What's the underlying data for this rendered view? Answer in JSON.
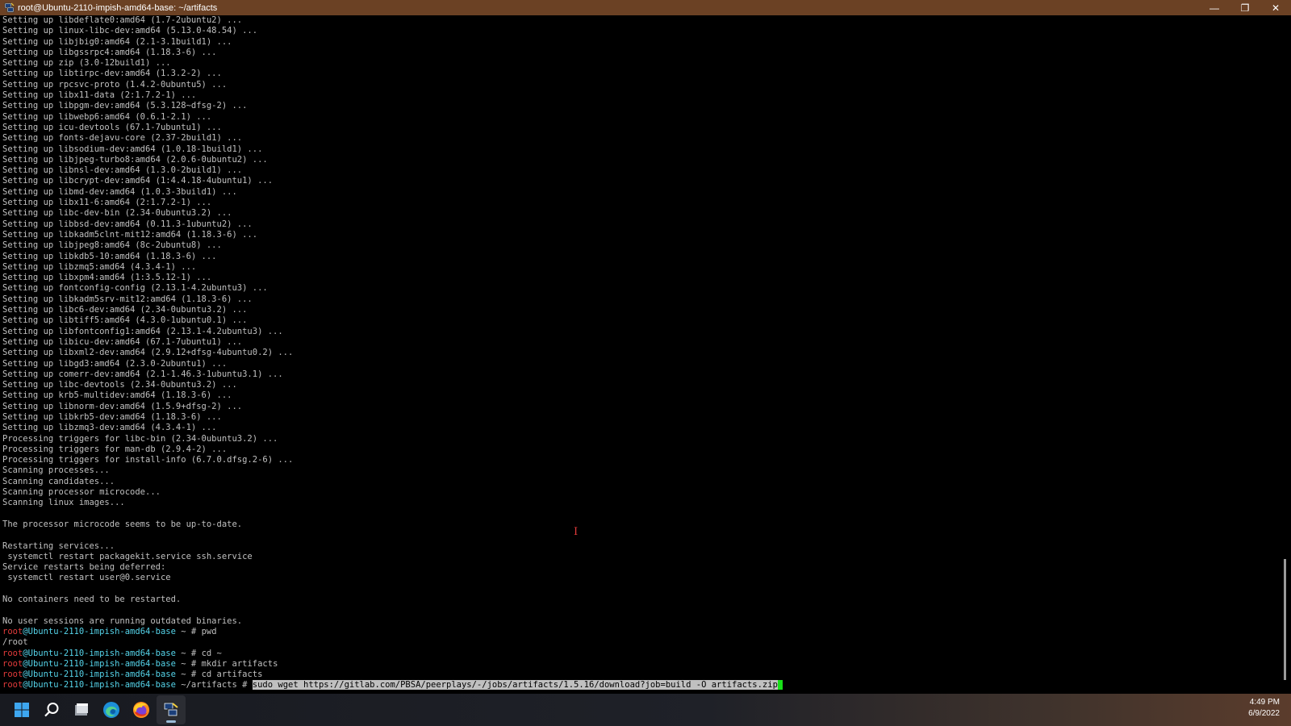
{
  "window": {
    "title": "root@Ubuntu-2110-impish-amd64-base: ~/artifacts",
    "minimize_label": "—",
    "maximize_label": "❐",
    "close_label": "✕"
  },
  "output_lines": [
    "Setting up libdeflate0:amd64 (1.7-2ubuntu2) ...",
    "Setting up linux-libc-dev:amd64 (5.13.0-48.54) ...",
    "Setting up libjbig0:amd64 (2.1-3.1build1) ...",
    "Setting up libgssrpc4:amd64 (1.18.3-6) ...",
    "Setting up zip (3.0-12build1) ...",
    "Setting up libtirpc-dev:amd64 (1.3.2-2) ...",
    "Setting up rpcsvc-proto (1.4.2-0ubuntu5) ...",
    "Setting up libx11-data (2:1.7.2-1) ...",
    "Setting up libpgm-dev:amd64 (5.3.128~dfsg-2) ...",
    "Setting up libwebp6:amd64 (0.6.1-2.1) ...",
    "Setting up icu-devtools (67.1-7ubuntu1) ...",
    "Setting up fonts-dejavu-core (2.37-2build1) ...",
    "Setting up libsodium-dev:amd64 (1.0.18-1build1) ...",
    "Setting up libjpeg-turbo8:amd64 (2.0.6-0ubuntu2) ...",
    "Setting up libnsl-dev:amd64 (1.3.0-2build1) ...",
    "Setting up libcrypt-dev:amd64 (1:4.4.18-4ubuntu1) ...",
    "Setting up libmd-dev:amd64 (1.0.3-3build1) ...",
    "Setting up libx11-6:amd64 (2:1.7.2-1) ...",
    "Setting up libc-dev-bin (2.34-0ubuntu3.2) ...",
    "Setting up libbsd-dev:amd64 (0.11.3-1ubuntu2) ...",
    "Setting up libkadm5clnt-mit12:amd64 (1.18.3-6) ...",
    "Setting up libjpeg8:amd64 (8c-2ubuntu8) ...",
    "Setting up libkdb5-10:amd64 (1.18.3-6) ...",
    "Setting up libzmq5:amd64 (4.3.4-1) ...",
    "Setting up libxpm4:amd64 (1:3.5.12-1) ...",
    "Setting up fontconfig-config (2.13.1-4.2ubuntu3) ...",
    "Setting up libkadm5srv-mit12:amd64 (1.18.3-6) ...",
    "Setting up libc6-dev:amd64 (2.34-0ubuntu3.2) ...",
    "Setting up libtiff5:amd64 (4.3.0-1ubuntu0.1) ...",
    "Setting up libfontconfig1:amd64 (2.13.1-4.2ubuntu3) ...",
    "Setting up libicu-dev:amd64 (67.1-7ubuntu1) ...",
    "Setting up libxml2-dev:amd64 (2.9.12+dfsg-4ubuntu0.2) ...",
    "Setting up libgd3:amd64 (2.3.0-2ubuntu1) ...",
    "Setting up comerr-dev:amd64 (2.1-1.46.3-1ubuntu3.1) ...",
    "Setting up libc-devtools (2.34-0ubuntu3.2) ...",
    "Setting up krb5-multidev:amd64 (1.18.3-6) ...",
    "Setting up libnorm-dev:amd64 (1.5.9+dfsg-2) ...",
    "Setting up libkrb5-dev:amd64 (1.18.3-6) ...",
    "Setting up libzmq3-dev:amd64 (4.3.4-1) ...",
    "Processing triggers for libc-bin (2.34-0ubuntu3.2) ...",
    "Processing triggers for man-db (2.9.4-2) ...",
    "Processing triggers for install-info (6.7.0.dfsg.2-6) ...",
    "Scanning processes...",
    "Scanning candidates...",
    "Scanning processor microcode...",
    "Scanning linux images...",
    "",
    "The processor microcode seems to be up-to-date.",
    "",
    "Restarting services...",
    " systemctl restart packagekit.service ssh.service",
    "Service restarts being deferred:",
    " systemctl restart user@0.service",
    "",
    "No containers need to be restarted.",
    "",
    "No user sessions are running outdated binaries."
  ],
  "prompt": {
    "user": "root",
    "host": "@Ubuntu-2110-impish-amd64-base"
  },
  "session": [
    {
      "path": " ~ # ",
      "cmd": "pwd",
      "output": "/root"
    },
    {
      "path": " ~ # ",
      "cmd": "cd ~"
    },
    {
      "path": " ~ # ",
      "cmd": "mkdir artifacts"
    },
    {
      "path": " ~ # ",
      "cmd": "cd artifacts"
    }
  ],
  "current": {
    "path": " ~/artifacts # ",
    "cmd": "sudo wget https://gitlab.com/PBSA/peerplays/-/jobs/artifacts/1.5.16/download?job=build -O artifacts.zip"
  },
  "mouse_cursor_glyph": "I",
  "taskbar": {
    "icons": [
      "windows-start-icon",
      "search-icon",
      "task-view-icon",
      "edge-browser-icon",
      "firefox-icon",
      "putty-icon"
    ],
    "time": "4:49 PM",
    "date": "6/9/2022"
  },
  "colors": {
    "titlebar": "#6b4124",
    "terminal_bg": "#000000",
    "terminal_fg": "#c0c0c0",
    "prompt_user": "#e33b3b",
    "prompt_host": "#55d4ea",
    "cursor": "#18e018"
  }
}
